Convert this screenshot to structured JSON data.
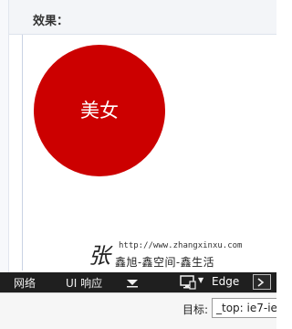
{
  "effect": {
    "title": "效果："
  },
  "demo": {
    "circle_text": "美女",
    "circle_color": "#cc0000"
  },
  "watermark": {
    "logo_char": "张",
    "url": "http://www.zhangxinxu.com",
    "slogan": "鑫旭-鑫空间-鑫生活"
  },
  "devtools": {
    "network_label": "网络",
    "ui_label": "UI 响应",
    "arrow_icon": "down-arrow-icon",
    "device_icon": "monitor-icon",
    "emulation_label": "Edge",
    "console_icon": "console-icon"
  },
  "target": {
    "label": "目标:",
    "value": "_top: ie7-ie"
  }
}
